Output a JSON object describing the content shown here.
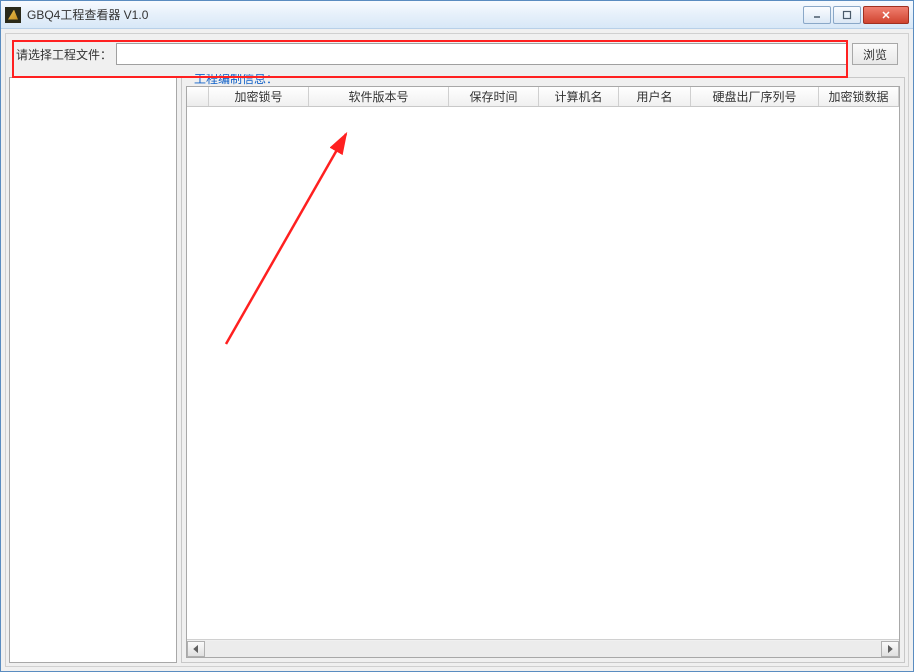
{
  "window": {
    "title": "GBQ4工程查看器 V1.0"
  },
  "fileSelect": {
    "label": "请选择工程文件：",
    "value": "",
    "browseLabel": "浏览"
  },
  "fieldset": {
    "legend": "工程编制信息："
  },
  "grid": {
    "columns": [
      {
        "label": "加密锁号",
        "width": 100
      },
      {
        "label": "软件版本号",
        "width": 140
      },
      {
        "label": "保存时间",
        "width": 90
      },
      {
        "label": "计算机名",
        "width": 80
      },
      {
        "label": "用户名",
        "width": 72
      },
      {
        "label": "硬盘出厂序列号",
        "width": 128
      },
      {
        "label": "加密锁数据",
        "width": 80
      }
    ]
  },
  "annotation": {
    "color": "#ff2020"
  }
}
